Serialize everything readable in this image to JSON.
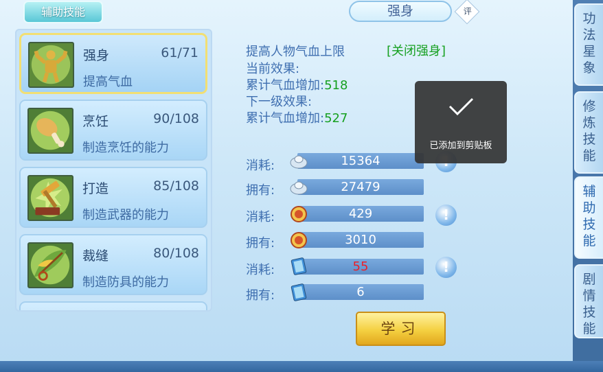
{
  "left_tab": {
    "label": "辅助技能"
  },
  "skills": [
    {
      "name": "强身",
      "level": "61/71",
      "desc": "提高气血",
      "selected": true,
      "icon": "muscle-man-icon"
    },
    {
      "name": "烹饪",
      "level": "90/108",
      "desc": "制造烹饪的能力",
      "selected": false,
      "icon": "drumstick-icon"
    },
    {
      "name": "打造",
      "level": "85/108",
      "desc": "制造武器的能力",
      "selected": false,
      "icon": "hammer-anvil-icon"
    },
    {
      "name": "裁缝",
      "level": "80/108",
      "desc": "制造防具的能力",
      "selected": false,
      "icon": "needle-leaf-icon"
    }
  ],
  "detail": {
    "title": "强身",
    "rate_badge": "评",
    "line1": "提高人物气血上限",
    "close_link": "[关闭强身]",
    "current_label": "当前效果:",
    "current_effect_label": "累计气血增加:",
    "current_effect_value": "518",
    "next_label": "下一级效果:",
    "next_effect_label": "累计气血增加:",
    "next_effect_value": "527"
  },
  "resources": [
    {
      "label": "消耗:",
      "value": "15364",
      "icon": "silver-ingot-icon",
      "warn": true,
      "red": false
    },
    {
      "label": "拥有:",
      "value": "27479",
      "icon": "silver-ingot-icon",
      "warn": false,
      "red": false
    },
    {
      "label": "消耗:",
      "value": "429",
      "icon": "contribution-coin-icon",
      "warn": true,
      "red": false
    },
    {
      "label": "拥有:",
      "value": "3010",
      "icon": "contribution-coin-icon",
      "warn": false,
      "red": false
    },
    {
      "label": "消耗:",
      "value": "55",
      "icon": "vitality-book-icon",
      "warn": true,
      "red": true
    },
    {
      "label": "拥有:",
      "value": "6",
      "icon": "vitality-book-icon",
      "warn": false,
      "red": false
    }
  ],
  "learn_button": "学习",
  "side_tabs": [
    {
      "label": "功法星象",
      "active": false
    },
    {
      "label": "修炼技能",
      "active": false
    },
    {
      "label": "辅助技能",
      "active": true
    },
    {
      "label": "剧情技能",
      "active": false
    }
  ],
  "toast": {
    "text": "已添加到剪贴板"
  },
  "colors": {
    "accent_green": "#16a020",
    "warning_red": "#e8202a",
    "button_gold": "#f4d041"
  }
}
